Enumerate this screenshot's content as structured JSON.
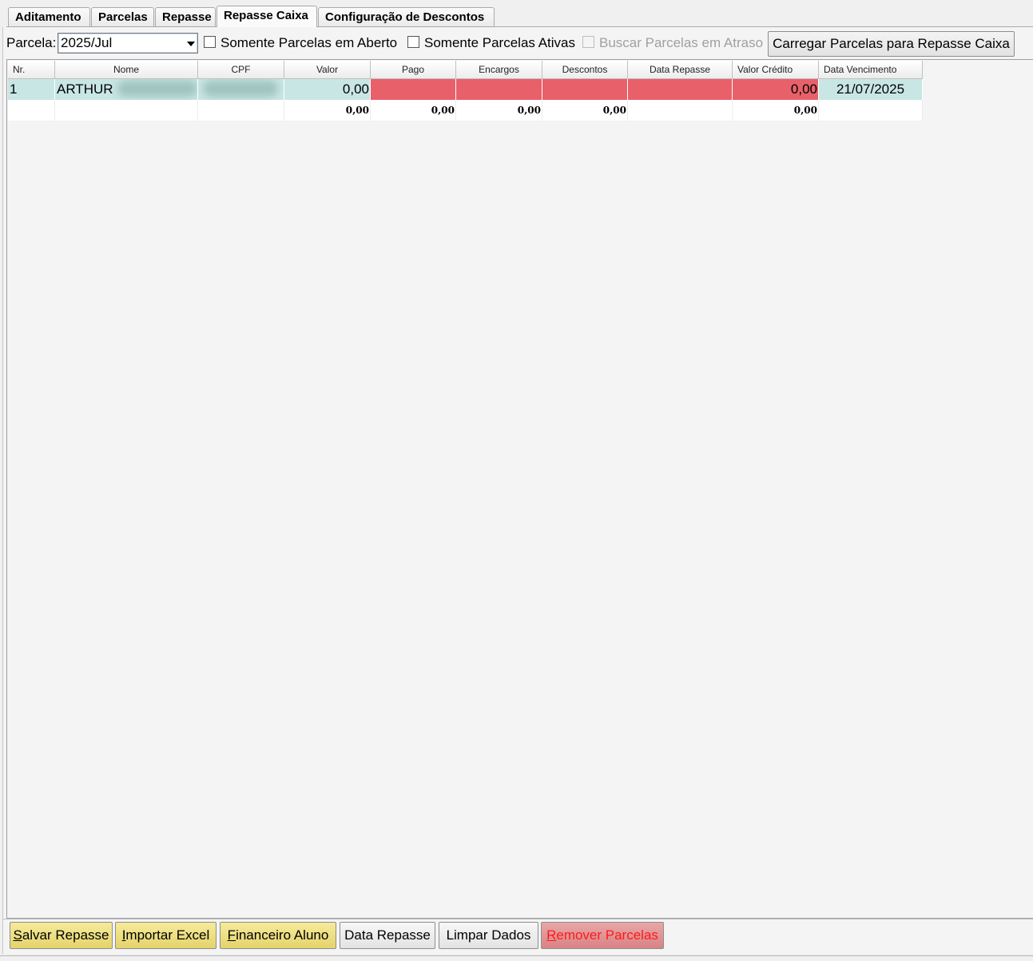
{
  "tabs": [
    {
      "label": "Aditamento",
      "active": false
    },
    {
      "label": "Parcelas",
      "active": false
    },
    {
      "label": "Repasse",
      "active": false
    },
    {
      "label": "Repasse Caixa",
      "active": true
    },
    {
      "label": "Configuração de Descontos",
      "active": false
    }
  ],
  "toolbar": {
    "parcela_label": "Parcela:",
    "parcela_value": "2025/Jul",
    "chk_aberto": "Somente Parcelas em Aberto",
    "chk_ativas": "Somente Parcelas Ativas",
    "chk_atraso": "Buscar Parcelas em Atraso",
    "load_button": "Carregar Parcelas para Repasse Caixa"
  },
  "grid": {
    "headers": [
      "Nr.",
      "Nome",
      "CPF",
      "Valor",
      "Pago",
      "Encargos",
      "Descontos",
      "Data Repasse",
      "Valor Crédito",
      "Data Vencimento"
    ],
    "rows": [
      {
        "nr": "1",
        "nome": "ARTHUR",
        "cpf": "",
        "valor": "0,00",
        "pago": "",
        "encargos": "",
        "descontos": "",
        "data_repasse": "",
        "valor_credito": "0,00",
        "data_vencimento": "21/07/2025"
      }
    ],
    "totals": {
      "valor": "0,00",
      "pago": "0,00",
      "encargos": "0,00",
      "descontos": "0,00",
      "valor_credito": "0,00"
    }
  },
  "buttons": {
    "salvar_u": "S",
    "salvar_rest": "alvar Repasse",
    "importar_u": "I",
    "importar_rest": "mportar Excel",
    "financeiro_u": "F",
    "financeiro_rest": "inanceiro Aluno",
    "data_repasse": "Data Repasse",
    "limpar": "Limpar Dados",
    "remover_u": "R",
    "remover_rest": "emover Parcelas"
  },
  "colors": {
    "accent_teal": "#c8e6e4",
    "alert_red": "#e8606a",
    "yellow_button": "#eede86"
  }
}
